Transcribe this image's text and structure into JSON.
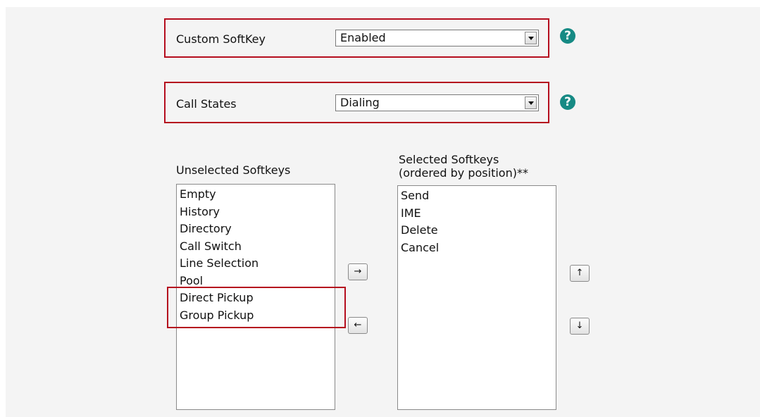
{
  "custom_softkey": {
    "label": "Custom SoftKey",
    "value": "Enabled",
    "help": "?"
  },
  "call_states": {
    "label": "Call States",
    "value": "Dialing",
    "help": "?"
  },
  "unselected": {
    "title": "Unselected Softkeys",
    "items": [
      "Empty",
      "History",
      "Directory",
      "Call Switch",
      "Line Selection",
      "Pool",
      "Direct Pickup",
      "Group Pickup"
    ]
  },
  "selected": {
    "title_line1": "Selected Softkeys",
    "title_line2": "(ordered by position)**",
    "items": [
      "Send",
      "IME",
      "Delete",
      "Cancel"
    ]
  },
  "buttons": {
    "add": "→",
    "remove": "←",
    "up": "↑",
    "down": "↓"
  },
  "colors": {
    "highlight": "#b50d1e",
    "help": "#168a84"
  }
}
